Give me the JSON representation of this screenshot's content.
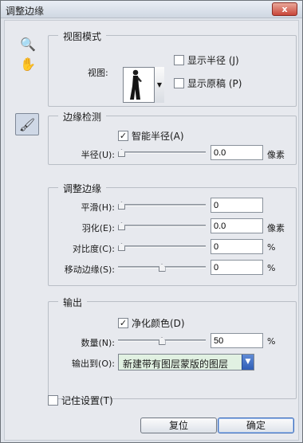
{
  "window": {
    "title": "调整边缘",
    "close_glyph": "x"
  },
  "tools": [
    {
      "icon": "zoom-icon",
      "glyph": "🔍"
    },
    {
      "icon": "hand-icon",
      "glyph": "✋"
    },
    {
      "icon": "refine-radius-brush-icon",
      "glyph": "🖌"
    }
  ],
  "view_mode": {
    "group_title": "视图模式",
    "view_label": "视图:",
    "show_radius_label": "显示半径 (J)",
    "show_radius_checked": false,
    "show_original_label": "显示原稿 (P)",
    "show_original_checked": false
  },
  "edge_detection": {
    "group_title": "边缘检测",
    "smart_radius_label": "智能半径(A)",
    "smart_radius_checked": true,
    "radius_label": "半径(U):",
    "radius_value": "0.0",
    "radius_unit": "像素",
    "radius_slider": 0
  },
  "adjust_edge": {
    "group_title": "调整边缘",
    "smooth_label": "平滑(H):",
    "smooth_value": "0",
    "smooth_slider": 0,
    "feather_label": "羽化(E):",
    "feather_value": "0.0",
    "feather_unit": "像素",
    "feather_slider": 0,
    "contrast_label": "对比度(C):",
    "contrast_value": "0",
    "contrast_unit": "%",
    "contrast_slider": 0,
    "shift_label": "移动边缘(S):",
    "shift_value": "0",
    "shift_unit": "%",
    "shift_slider": 0.5
  },
  "output": {
    "group_title": "输出",
    "decontaminate_label": "净化颜色(D)",
    "decontaminate_checked": true,
    "amount_label": "数量(N):",
    "amount_value": "50",
    "amount_unit": "%",
    "amount_slider": 0.5,
    "output_to_label": "输出到(O):",
    "output_to_value": "新建带有图层蒙版的图层"
  },
  "footer": {
    "remember_label": "记住设置(T)",
    "remember_checked": false,
    "reset_label": "复位",
    "ok_label": "确定"
  }
}
